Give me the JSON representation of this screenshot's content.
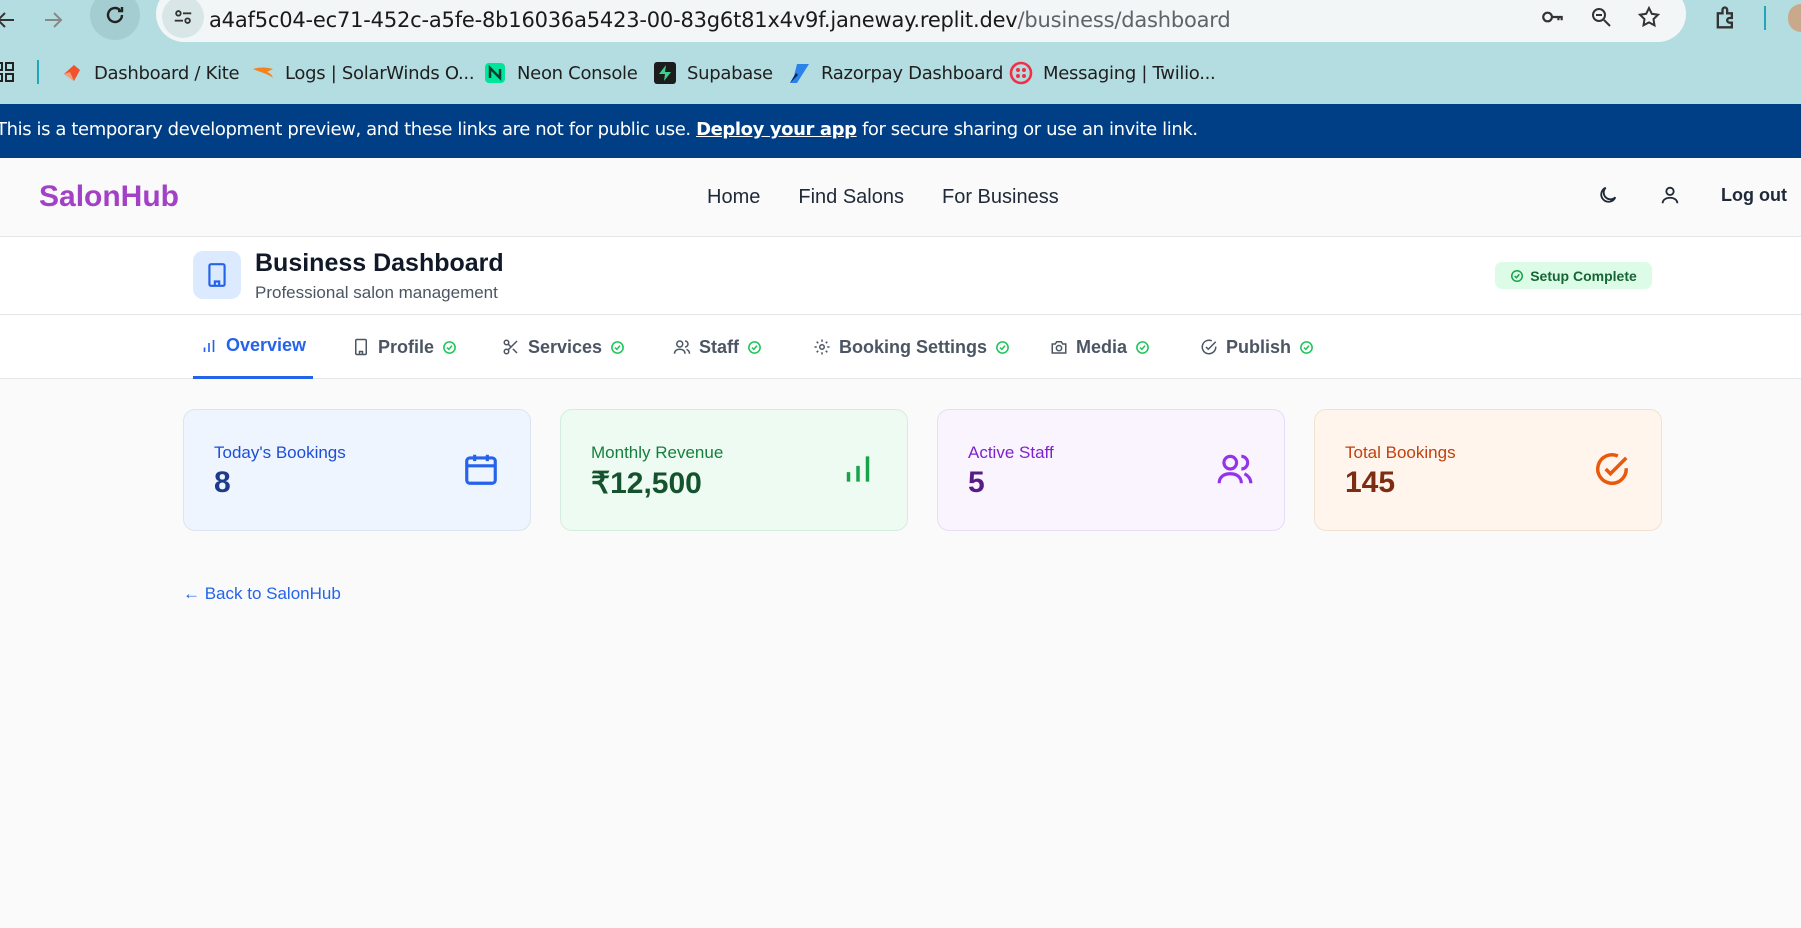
{
  "browser": {
    "url_host": "a4af5c04-ec71-452c-a5fe-8b16036a5423-00-83g6t81x4v9f.janeway.replit.dev",
    "url_path": "/business/dashboard",
    "bookmarks": [
      {
        "label": "Dashboard / Kite",
        "color": "#f0522b"
      },
      {
        "label": "Logs | SolarWinds O...",
        "color": "#f5821f"
      },
      {
        "label": "Neon Console",
        "color": "#00e599"
      },
      {
        "label": "Supabase",
        "color": "#3ecf8e"
      },
      {
        "label": "Razorpay Dashboard",
        "color": "#2b83ea"
      },
      {
        "label": "Messaging | Twilio...",
        "color": "#f22f46"
      }
    ]
  },
  "banner": {
    "prefix": "This is a temporary development preview, and these links are not for public use.",
    "link": "Deploy your app",
    "suffix": "for secure sharing or use an invite link."
  },
  "header": {
    "logo": "SalonHub",
    "nav": [
      "Home",
      "Find Salons",
      "For Business"
    ],
    "logout": "Log out"
  },
  "dashboard": {
    "title": "Business Dashboard",
    "subtitle": "Professional salon management",
    "badge": "Setup Complete"
  },
  "tabs": [
    {
      "label": "Overview",
      "icon": "bar-chart-icon",
      "active": true,
      "complete": false
    },
    {
      "label": "Profile",
      "icon": "building-icon",
      "active": false,
      "complete": true
    },
    {
      "label": "Services",
      "icon": "scissors-icon",
      "active": false,
      "complete": true
    },
    {
      "label": "Staff",
      "icon": "users-icon",
      "active": false,
      "complete": true
    },
    {
      "label": "Booking Settings",
      "icon": "gear-icon",
      "active": false,
      "complete": true
    },
    {
      "label": "Media",
      "icon": "camera-icon",
      "active": false,
      "complete": true
    },
    {
      "label": "Publish",
      "icon": "check-circle-icon",
      "active": false,
      "complete": true
    }
  ],
  "stats": [
    {
      "label": "Today's Bookings",
      "value": "8",
      "icon": "calendar-icon"
    },
    {
      "label": "Monthly Revenue",
      "value": "₹12,500",
      "icon": "bar-chart-icon"
    },
    {
      "label": "Active Staff",
      "value": "5",
      "icon": "users-icon"
    },
    {
      "label": "Total Bookings",
      "value": "145",
      "icon": "check-circle-icon"
    }
  ],
  "back_link": "← Back to SalonHub",
  "colors": {
    "brand": "#a341c6",
    "accent": "#2563eb",
    "banner": "#003f85",
    "success": "#22c55e"
  }
}
